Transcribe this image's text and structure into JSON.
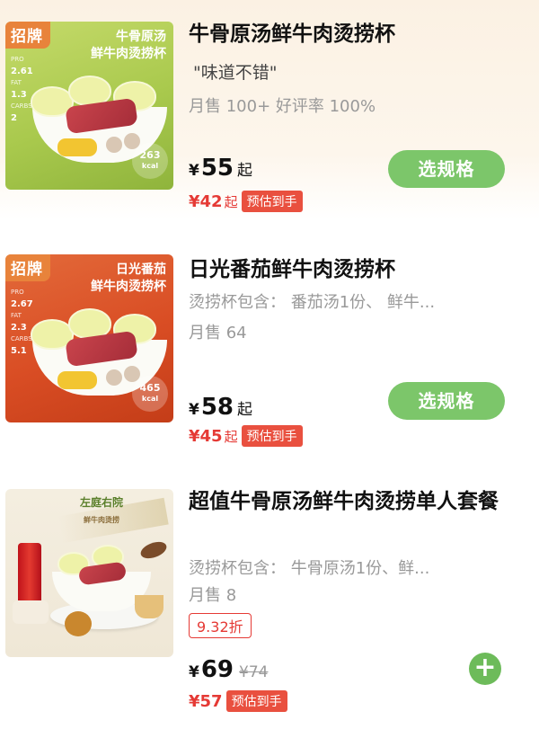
{
  "colors": {
    "accent_green": "#7cc66a",
    "price_red": "#e53a35",
    "badge_orange": "#e8833b"
  },
  "items": [
    {
      "badge": "招牌",
      "image_title_line1": "牛骨原汤",
      "image_title_line2": "鲜牛肉烫捞杯",
      "image_nutrition": [
        "2.61",
        "1.3",
        "2"
      ],
      "image_kcal": "263",
      "image_kcal_unit": "kcal",
      "title": "牛骨原汤鲜牛肉烫捞杯",
      "review": "\"味道不错\"",
      "sales": "月售 100+ 好评率 100%",
      "currency": "¥",
      "price": "55",
      "price_suffix": "起",
      "est_price": "¥42",
      "est_suffix": "起",
      "est_tag": "预估到手",
      "action_label": "选规格"
    },
    {
      "badge": "招牌",
      "image_title_line1": "日光番茄",
      "image_title_line2": "鲜牛肉烫捞杯",
      "image_nutrition": [
        "2.67",
        "2.3",
        "5.1"
      ],
      "image_kcal": "465",
      "image_kcal_unit": "kcal",
      "title": "日光番茄鲜牛肉烫捞杯",
      "subtitle": "烫捞杯包含： 番茄汤1份、 鲜牛...",
      "sales": "月售 64",
      "currency": "¥",
      "price": "58",
      "price_suffix": "起",
      "est_price": "¥45",
      "est_suffix": "起",
      "est_tag": "预估到手",
      "action_label": "选规格"
    },
    {
      "image_title_line1": "左庭右院",
      "image_title_line2": "鲜牛肉烫捞",
      "title": "超值牛骨原汤鲜牛肉烫捞单人套餐",
      "subtitle": "烫捞杯包含： 牛骨原汤1份、鲜...",
      "sales": "月售 8",
      "discount": "9.32折",
      "currency": "¥",
      "price": "69",
      "original_price": "¥74",
      "est_price": "¥57",
      "est_tag": "预估到手",
      "action_icon": "plus-icon",
      "action_label": "+"
    }
  ]
}
